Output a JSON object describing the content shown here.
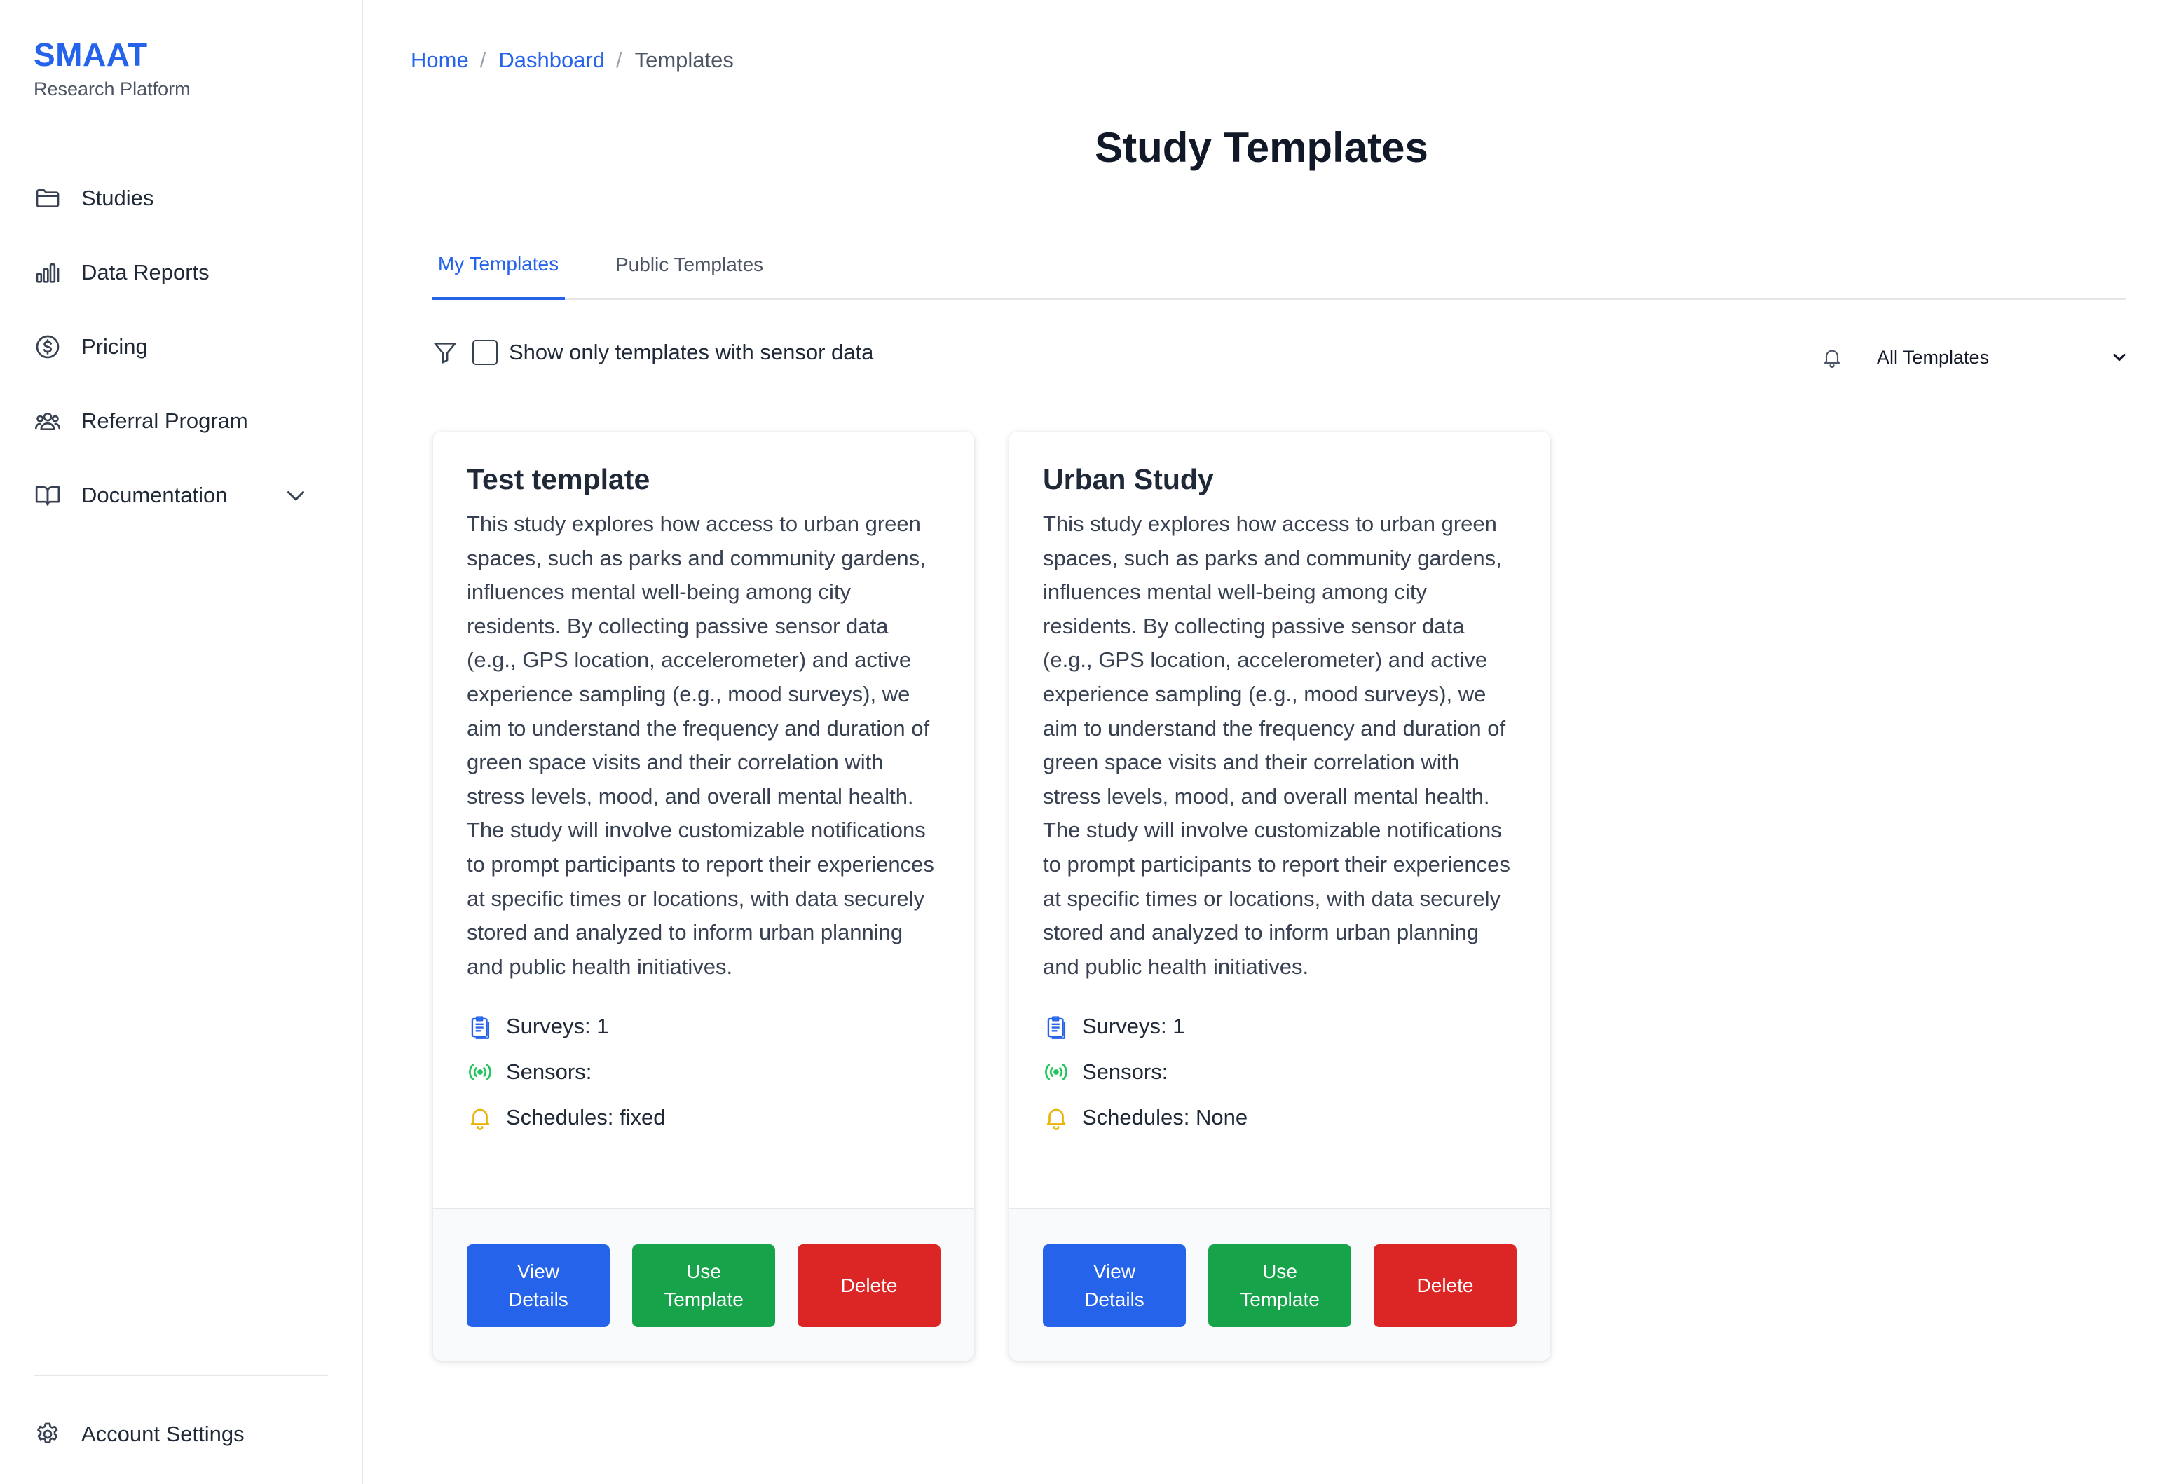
{
  "brand": {
    "name": "SMAAT",
    "subtitle": "Research Platform"
  },
  "sidebar": {
    "items": [
      {
        "label": "Studies",
        "icon": "folder-icon"
      },
      {
        "label": "Data Reports",
        "icon": "bar-chart-icon"
      },
      {
        "label": "Pricing",
        "icon": "dollar-circle-icon"
      },
      {
        "label": "Referral Program",
        "icon": "users-icon"
      },
      {
        "label": "Documentation",
        "icon": "book-icon"
      }
    ],
    "account_settings": "Account Settings"
  },
  "breadcrumb": {
    "home": "Home",
    "dashboard": "Dashboard",
    "current": "Templates",
    "separator": "/"
  },
  "page_title": "Study Templates",
  "tabs": {
    "my_templates": "My Templates",
    "public_templates": "Public Templates"
  },
  "filter": {
    "sensor_checkbox_label": "Show only templates with sensor data",
    "select_value": "All Templates"
  },
  "cards": [
    {
      "title": "Test template",
      "description": "This study explores how access to urban green spaces, such as parks and community gardens, influences mental well-being among city residents. By collecting passive sensor data (e.g., GPS location, accelerometer) and active experience sampling (e.g., mood surveys), we aim to understand the frequency and duration of green space visits and their correlation with stress levels, mood, and overall mental health. The study will involve customizable notifications to prompt participants to report their experiences at specific times or locations, with data securely stored and analyzed to inform urban planning and public health initiatives.",
      "surveys": "Surveys: 1",
      "sensors": "Sensors:",
      "schedules": "Schedules: fixed",
      "buttons": {
        "view": "View\nDetails",
        "use": "Use\nTemplate",
        "delete": "Delete"
      }
    },
    {
      "title": "Urban Study",
      "description": "This study explores how access to urban green spaces, such as parks and community gardens, influences mental well-being among city residents. By collecting passive sensor data (e.g., GPS location, accelerometer) and active experience sampling (e.g., mood surveys), we aim to understand the frequency and duration of green space visits and their correlation with stress levels, mood, and overall mental health. The study will involve customizable notifications to prompt participants to report their experiences at specific times or locations, with data securely stored and analyzed to inform urban planning and public health initiatives.",
      "surveys": "Surveys: 1",
      "sensors": "Sensors:",
      "schedules": "Schedules: None",
      "buttons": {
        "view": "View\nDetails",
        "use": "Use\nTemplate",
        "delete": "Delete"
      }
    }
  ],
  "colors": {
    "accent": "#2563eb",
    "success": "#16a34a",
    "danger": "#dc2626",
    "warning": "#eab308"
  }
}
